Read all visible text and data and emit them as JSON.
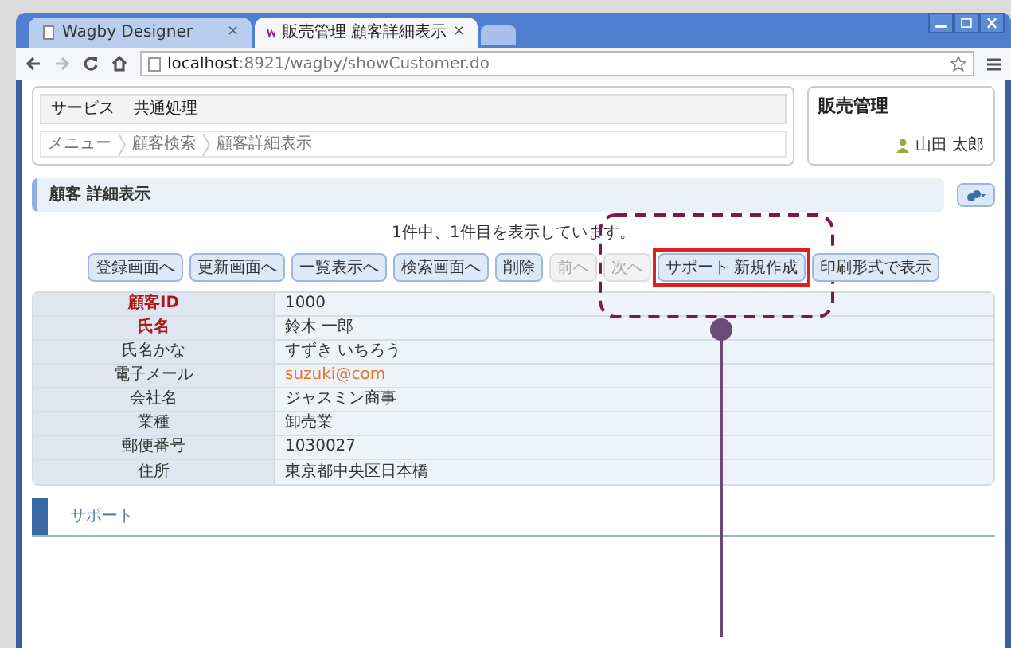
{
  "browser": {
    "tabs": [
      {
        "title": "Wagby Designer",
        "close": "×",
        "selected": false
      },
      {
        "title": "販売管理 顧客詳細表示",
        "close": "×",
        "selected": true
      }
    ],
    "url_host": "localhost",
    "url_rest": ":8921/wagby/showCustomer.do"
  },
  "menu": {
    "items": [
      "サービス",
      "共通処理"
    ],
    "breadcrumb": [
      "メニュー",
      "顧客検索",
      "顧客詳細表示"
    ]
  },
  "app": {
    "title": "販売管理",
    "user": "山田 太郎"
  },
  "panel": {
    "title": "顧客 詳細表示",
    "status": "1件中、1件目を表示しています。",
    "buttons": [
      {
        "label": "登録画面へ",
        "disabled": false,
        "highlighted": false
      },
      {
        "label": "更新画面へ",
        "disabled": false,
        "highlighted": false
      },
      {
        "label": "一覧表示へ",
        "disabled": false,
        "highlighted": false
      },
      {
        "label": "検索画面へ",
        "disabled": false,
        "highlighted": false
      },
      {
        "label": "削除",
        "disabled": false,
        "highlighted": false
      },
      {
        "label": "前へ",
        "disabled": true,
        "highlighted": false
      },
      {
        "label": "次へ",
        "disabled": true,
        "highlighted": false
      },
      {
        "label": "サポート 新規作成",
        "disabled": false,
        "highlighted": true
      },
      {
        "label": "印刷形式で表示",
        "disabled": false,
        "highlighted": false
      }
    ],
    "fields": [
      {
        "label": "顧客ID",
        "required": true,
        "kind": "text",
        "value": "1000"
      },
      {
        "label": "氏名",
        "required": true,
        "kind": "text",
        "value": "鈴木 一郎"
      },
      {
        "label": "氏名かな",
        "required": false,
        "kind": "text",
        "value": "すずき いちろう"
      },
      {
        "label": "電子メール",
        "required": false,
        "kind": "link",
        "value": "suzuki@com"
      },
      {
        "label": "会社名",
        "required": false,
        "kind": "text",
        "value": "ジャスミン商事"
      },
      {
        "label": "業種",
        "required": false,
        "kind": "text",
        "value": "卸売業"
      },
      {
        "label": "郵便番号",
        "required": false,
        "kind": "text",
        "value": "1030027"
      },
      {
        "label": "住所",
        "required": false,
        "kind": "text",
        "value": "東京都中央区日本橋"
      }
    ],
    "section": {
      "title": "サポート"
    }
  }
}
